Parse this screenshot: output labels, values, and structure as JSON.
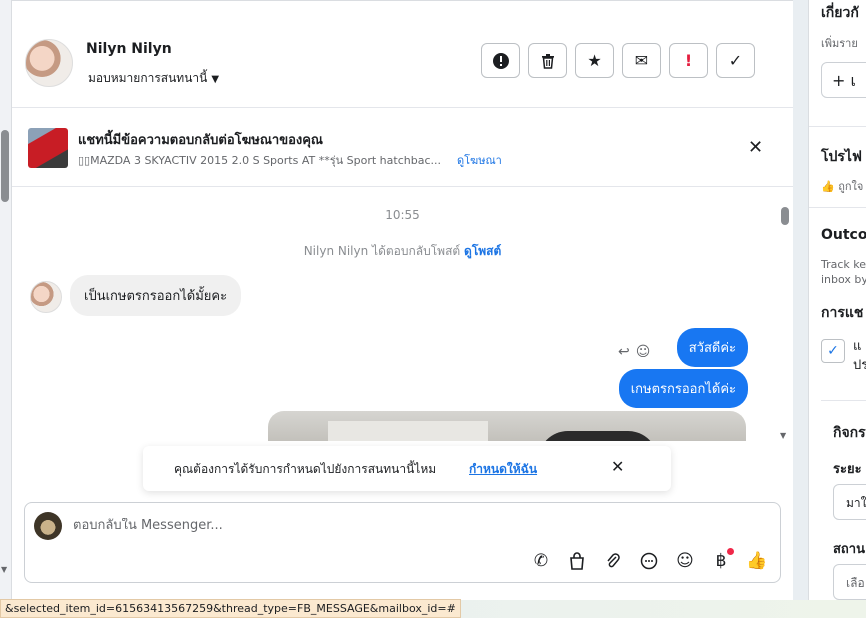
{
  "contact": {
    "name": "Nilyn Nilyn",
    "assign_label": "มอบหมายการสนทนานี้"
  },
  "actions": {
    "spam": "!",
    "delete": "🗑",
    "star": "★",
    "email": "✉",
    "flag": "!",
    "done": "✓"
  },
  "ad": {
    "title": "แชทนี้มีข้อความตอบกลับต่อโฆษณาของคุณ",
    "subtitle": "▯▯MAZDA 3 SKYACTIV 2015 2.0 S Sports AT **รุ่น Sport hatchbac...",
    "link": "ดูโฆษณา"
  },
  "chat": {
    "timestamp": "10:55",
    "system_text": "Nilyn Nilyn ได้ตอบกลับโพสต์",
    "system_link": "ดูโพสต์",
    "messages": [
      {
        "direction": "in",
        "text": "เป็นเกษตรกรออกได้มั้ยคะ"
      },
      {
        "direction": "out",
        "text": "สวัสดีค่ะ"
      },
      {
        "direction": "out",
        "text": "เกษตรกรออกได้ค่ะ"
      }
    ]
  },
  "toast": {
    "text": "คุณต้องการได้รับการกำหนดไปยังการสนทนานี้ไหม",
    "link": "กำหนดให้ฉัน"
  },
  "composer": {
    "placeholder": "ตอบกลับใน Messenger..."
  },
  "right_panel": {
    "about_title": "เกี่ยวกั",
    "about_sub": "เพิ่มราย",
    "add_button": "+ เ",
    "profile_title": "โปรไฟ",
    "profile_sub": "ถูกใจ",
    "outcome_title": "Outco",
    "outcome_sub1": "Track ke",
    "outcome_sub2": "inbox by",
    "chat_label": "การแช",
    "check_label1": "แ",
    "check_label2": "ปร",
    "activity_title": "กิจกร",
    "period_label": "ระยะ",
    "period_value": "มาใ",
    "status_label": "สถาน",
    "status_value": "เลือ"
  },
  "status_url": "&selected_item_id=61563413567259&thread_type=FB_MESSAGE&mailbox_id=#"
}
